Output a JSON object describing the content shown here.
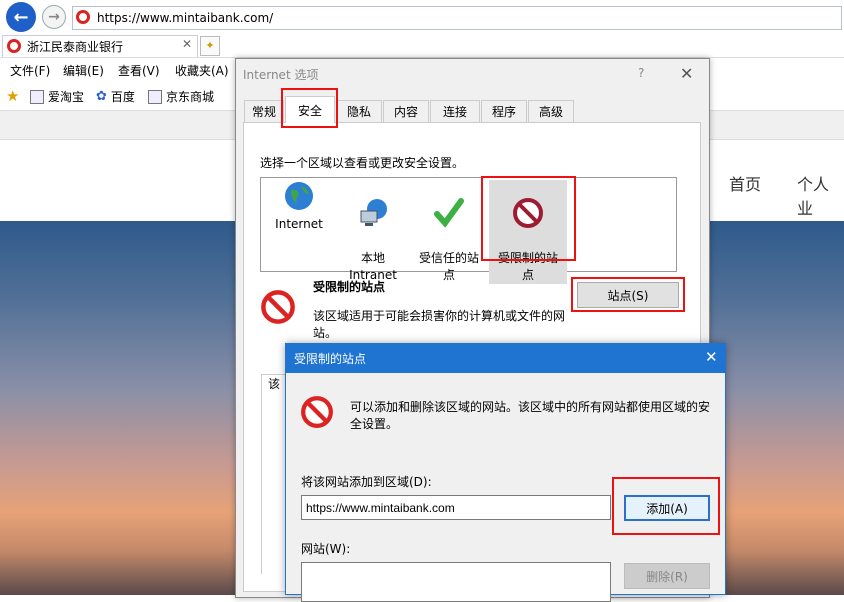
{
  "browser": {
    "url": "https://www.mintaibank.com/",
    "tab_title": "浙江民泰商业银行",
    "menus": [
      "文件(F)",
      "编辑(E)",
      "查看(V)",
      "收藏夹(A)"
    ],
    "favorites": [
      "爱淘宝",
      "百度",
      "京东商城"
    ]
  },
  "site": {
    "nav": [
      "首页",
      "个人业"
    ]
  },
  "internet_options": {
    "title": "Internet 选项",
    "help": "?",
    "tabs": [
      "常规",
      "安全",
      "隐私",
      "内容",
      "连接",
      "程序",
      "高级"
    ],
    "zone_caption": "选择一个区域以查看或更改安全设置。",
    "zones": [
      {
        "name": "Internet",
        "icon": "globe-icon"
      },
      {
        "name": "本地\nIntranet",
        "icon": "intranet-icon"
      },
      {
        "name": "受信任的站\n点",
        "icon": "trusted-check-icon"
      },
      {
        "name": "受限制的站\n点",
        "icon": "restricted-icon"
      }
    ],
    "selected_zone_title": "受限制的站点",
    "selected_zone_desc": "该区域适用于可能会损害你的计算机或文件的网站。",
    "sites_button": "站点(S)",
    "partial_label": "该"
  },
  "restricted_dialog": {
    "title": "受限制的站点",
    "description": "可以添加和删除该区域的网站。该区域中的所有网站都使用区域的安全设置。",
    "add_label": "将该网站添加到区域(D):",
    "input_value": "https://www.mintaibank.com",
    "add_button": "添加(A)",
    "websites_label": "网站(W):",
    "remove_button": "删除(R)"
  },
  "colors": {
    "accent": "#1e74d0",
    "highlight": "#ee1111"
  }
}
